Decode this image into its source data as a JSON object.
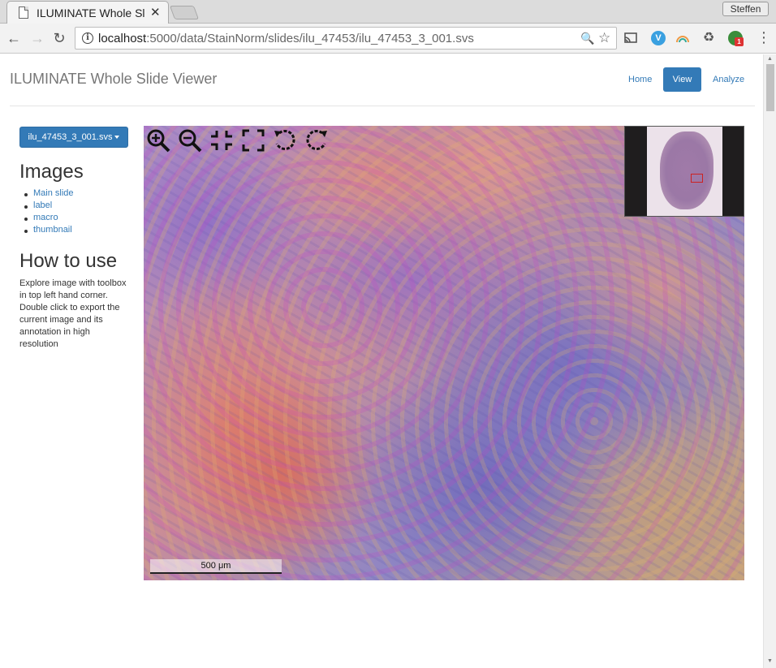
{
  "browser": {
    "tab_title": "ILUMINATE Whole Sl",
    "tab_close": "✕",
    "profile_name": "Steffen",
    "url_host": "localhost",
    "url_path": ":5000/data/StainNorm/slides/ilu_47453/ilu_47453_3_001.svs",
    "extension_badge": "1",
    "icons": [
      "back-icon",
      "forward-icon",
      "reload-icon",
      "info-icon",
      "zoom-icon",
      "star-icon",
      "cast-icon",
      "menu-icon"
    ]
  },
  "header": {
    "brand": "ILUMINATE Whole Slide Viewer",
    "nav": [
      {
        "label": "Home",
        "active": false
      },
      {
        "label": "View",
        "active": true
      },
      {
        "label": "Analyze",
        "active": false
      }
    ]
  },
  "sidebar": {
    "slide_select": "ilu_47453_3_001.svs",
    "images_heading": "Images",
    "images": [
      "Main slide",
      "label",
      "macro",
      "thumbnail"
    ],
    "howto_heading": "How to use",
    "howto_text": "Explore image with toolbox in top left hand corner. Double click to export the current image and its annotation in high resolution"
  },
  "viewer": {
    "tools": [
      "zoom-in-icon",
      "zoom-out-icon",
      "home-icon",
      "fullscreen-icon",
      "rotate-left-icon",
      "rotate-right-icon"
    ],
    "scalebar_label": "500 μm"
  },
  "colors": {
    "accent": "#337ab7",
    "brand_text": "#777777",
    "navigator_box": "#cc2222"
  }
}
